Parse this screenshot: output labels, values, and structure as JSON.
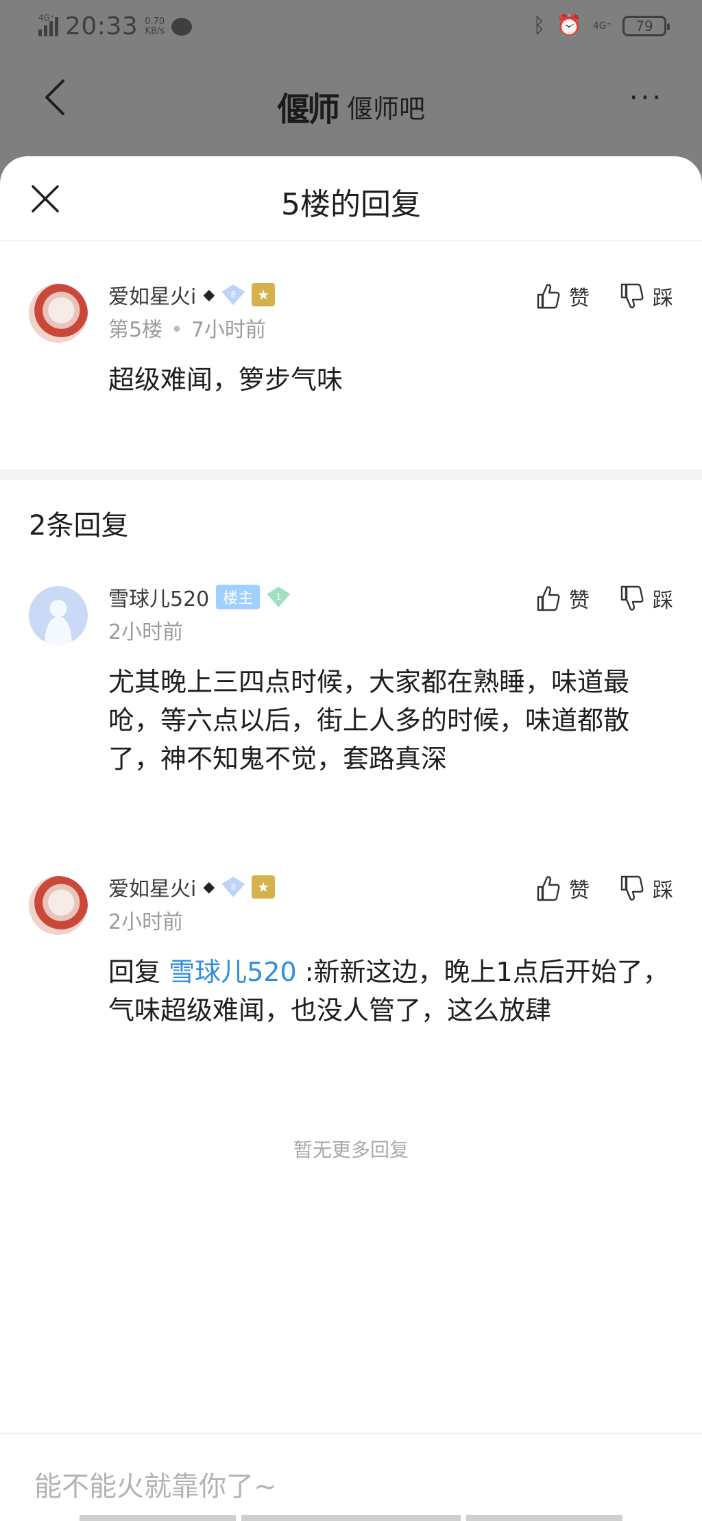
{
  "status": {
    "net": "4G⁺",
    "time": "20:33",
    "speed_value": "0.70",
    "speed_unit": "KB/s",
    "net_right": "4G⁺",
    "battery": "79"
  },
  "appbar": {
    "logo_mark": "偃师",
    "title": "偃师吧",
    "more": "···"
  },
  "sheet": {
    "title": "5楼的回复"
  },
  "main_post": {
    "user": "爱如星火i",
    "user_mark": "◆",
    "level": "8",
    "floor": "第5楼",
    "time": "7小时前",
    "content": "超级难闻，箩步气味",
    "like_label": "赞",
    "dislike_label": "踩"
  },
  "replies_header": "2条回复",
  "replies": [
    {
      "user": "雪球儿520",
      "badge": "楼主",
      "level": "1",
      "time": "2小时前",
      "content": "尤其晚上三四点时候，大家都在熟睡，味道最呛，等六点以后，街上人多的时候，味道都散了，神不知鬼不觉，套路真深",
      "like_label": "赞",
      "dislike_label": "踩"
    },
    {
      "user": "爱如星火i",
      "user_mark": "◆",
      "level": "8",
      "time": "2小时前",
      "reply_prefix": "回复",
      "reply_to": "雪球儿520",
      "content": " :新新这边，晚上1点后开始了，气味超级难闻，也没人管了，这么放肆",
      "like_label": "赞",
      "dislike_label": "踩"
    }
  ],
  "no_more": "暂无更多回复",
  "input": {
    "placeholder": "能不能火就靠你了~"
  },
  "colors": {
    "link": "#2f8ee0",
    "dim_overlay": "#7f7f7f",
    "owner_badge": "#9fd0ff"
  }
}
